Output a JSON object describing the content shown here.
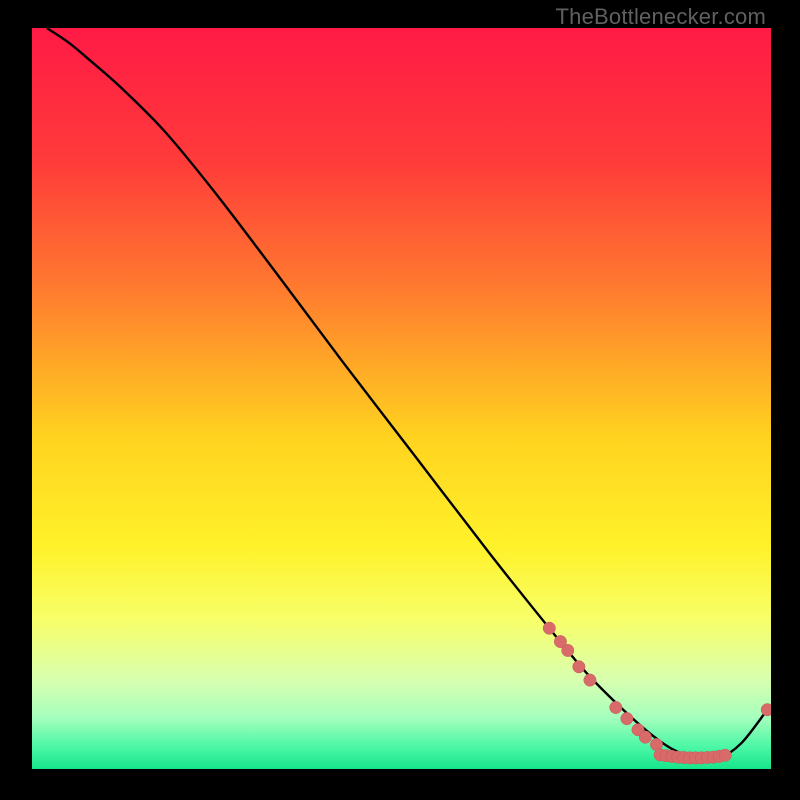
{
  "watermark": "TheBottlenecker.com",
  "colors": {
    "gradient_stops": [
      {
        "offset": 0.0,
        "color": "#ff1a46"
      },
      {
        "offset": 0.18,
        "color": "#ff3b3a"
      },
      {
        "offset": 0.35,
        "color": "#ff7a2f"
      },
      {
        "offset": 0.55,
        "color": "#ffd21f"
      },
      {
        "offset": 0.7,
        "color": "#fff22a"
      },
      {
        "offset": 0.8,
        "color": "#f7ff6a"
      },
      {
        "offset": 0.88,
        "color": "#d8ffb0"
      },
      {
        "offset": 0.93,
        "color": "#a6ffbd"
      },
      {
        "offset": 0.97,
        "color": "#4cf7a6"
      },
      {
        "offset": 1.0,
        "color": "#17e58a"
      }
    ],
    "line": "#000000",
    "dot_fill": "#d86a6a",
    "dot_stroke": "#c45a5a"
  },
  "chart_data": {
    "type": "line",
    "title": "",
    "xlabel": "",
    "ylabel": "",
    "xlim": [
      0,
      100
    ],
    "ylim": [
      0,
      100
    ],
    "series": [
      {
        "name": "curve",
        "x": [
          2,
          5,
          8,
          12,
          18,
          25,
          33,
          42,
          52,
          62,
          70,
          75,
          80,
          84,
          87,
          90,
          93,
          96,
          99.5
        ],
        "y": [
          100,
          98,
          95.5,
          92,
          86,
          77.5,
          67,
          55,
          42,
          29,
          19,
          13,
          8,
          4.5,
          2.5,
          1.5,
          1.5,
          3.5,
          8
        ]
      }
    ],
    "dot_clusters": [
      {
        "name": "upper-cluster",
        "points": [
          {
            "x": 70.0,
            "y": 19.0
          },
          {
            "x": 71.5,
            "y": 17.2
          },
          {
            "x": 72.5,
            "y": 16.0
          },
          {
            "x": 74.0,
            "y": 13.8
          },
          {
            "x": 75.5,
            "y": 12.0
          }
        ]
      },
      {
        "name": "lower-cluster",
        "points": [
          {
            "x": 79.0,
            "y": 8.3
          },
          {
            "x": 80.5,
            "y": 6.8
          },
          {
            "x": 82.0,
            "y": 5.3
          },
          {
            "x": 83.0,
            "y": 4.3
          },
          {
            "x": 84.5,
            "y": 3.3
          }
        ]
      },
      {
        "name": "trough-dense",
        "points": [
          {
            "x": 85.0,
            "y": 1.9
          },
          {
            "x": 85.8,
            "y": 1.8
          },
          {
            "x": 86.6,
            "y": 1.7
          },
          {
            "x": 87.4,
            "y": 1.6
          },
          {
            "x": 88.2,
            "y": 1.55
          },
          {
            "x": 89.0,
            "y": 1.5
          },
          {
            "x": 89.8,
            "y": 1.5
          },
          {
            "x": 90.6,
            "y": 1.5
          },
          {
            "x": 91.4,
            "y": 1.55
          },
          {
            "x": 92.2,
            "y": 1.6
          },
          {
            "x": 93.0,
            "y": 1.7
          },
          {
            "x": 93.8,
            "y": 1.85
          }
        ]
      },
      {
        "name": "tail",
        "points": [
          {
            "x": 99.5,
            "y": 8.0
          }
        ]
      }
    ]
  }
}
